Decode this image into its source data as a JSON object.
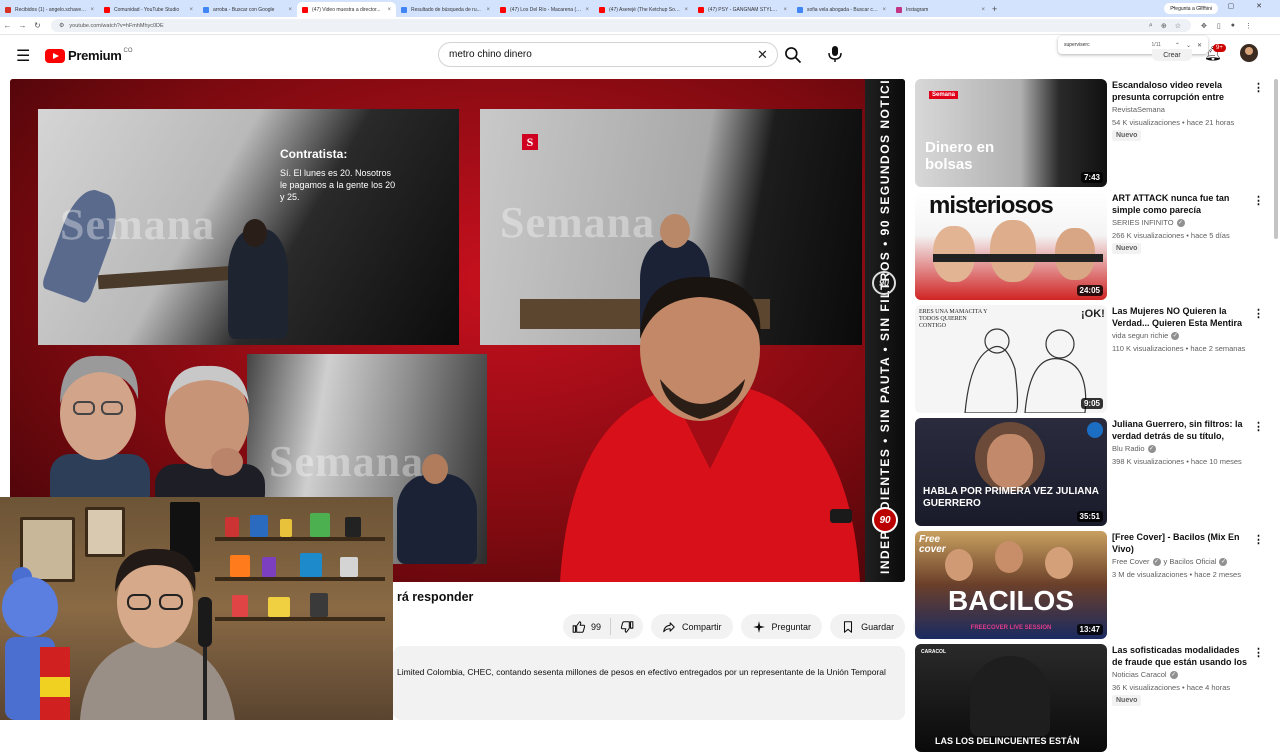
{
  "browser": {
    "tabs": [
      {
        "label": "Recibidos (1) - angelo.schavez...",
        "color": "#d93025",
        "active": false
      },
      {
        "label": "Comunidad - YouTube Studio",
        "color": "#ff0000",
        "active": false
      },
      {
        "label": "arroba - Buscar con Google",
        "color": "#4285f4",
        "active": false
      },
      {
        "label": "(47) Video muestra a director...",
        "color": "#ff0000",
        "active": true
      },
      {
        "label": "Resultado de búsqueda de ru...",
        "color": "#4285f4",
        "active": false
      },
      {
        "label": "(47) Los Del Río - Macarena (L...",
        "color": "#ff0000",
        "active": false
      },
      {
        "label": "(47) Aserejé (The Ketchup Song...",
        "color": "#ff0000",
        "active": false
      },
      {
        "label": "(47) PSY - GANGNAM STYLE(...",
        "color": "#ff0000",
        "active": false
      },
      {
        "label": "sofia vela abogada - Buscar co...",
        "color": "#4285f4",
        "active": false
      },
      {
        "label": "Instagram",
        "color": "#c13584",
        "active": false
      }
    ],
    "gemini_label": "Pregunta a Gemini",
    "url": "youtube.com/watch?v=hFmhMhyc0DE"
  },
  "header": {
    "logo_text": "Premium",
    "logo_country": "CO",
    "search_value": "metro chino dinero",
    "create_label": "Crear",
    "notif_count": "9+"
  },
  "findbar": {
    "query": "superviserc",
    "count": "1/11"
  },
  "player": {
    "caption_title": "Contratista:",
    "caption_body": "Sí. El lunes es 20. Nosotros le pagamos a la gente los 20 y 25.",
    "watermark": "Semana",
    "s_logo": "S",
    "vertical_text": "INDEPENDIENTES • SIN PAUTA • SIN FILTROS • 90 SEGUNDOS NOTICIAS",
    "badge": "90"
  },
  "video": {
    "title_fragment": "rá responder",
    "likes": "99",
    "share_label": "Compartir",
    "ask_label": "Preguntar",
    "save_label": "Guardar",
    "description": "Limited Colombia, CHEC, contando sesenta millones de pesos en efectivo entregados por un representante de la Unión Temporal"
  },
  "recommendations": [
    {
      "title": "Escandaloso video revela presunta corrupción entre contratistas del ...",
      "channel": "RevistaSemana",
      "verified": false,
      "meta": "54 K visualizaciones • hace 21 horas",
      "duration": "7:43",
      "new": "Nuevo",
      "thumb_text": "Dinero en bolsas",
      "thumb_tag": "Semana"
    },
    {
      "title": "ART ATTACK nunca fue tan simple como parecía",
      "channel": "SERIES INFINITO",
      "verified": true,
      "meta": "266 K visualizaciones • hace 5 días",
      "duration": "24:05",
      "new": "Nuevo",
      "thumb_text": "misteriosos"
    },
    {
      "title": "Las Mujeres NO Quieren la Verdad... Quieren Esta Mentira ...",
      "channel": "vida segun richie",
      "verified": true,
      "meta": "110 K visualizaciones • hace 2 semanas",
      "duration": "9:05",
      "new": "",
      "thumb_text": "ERES UNA MAMACITA Y TODOS QUIEREN CONTIGO",
      "thumb_tag": "¡OK!"
    },
    {
      "title": "Juliana Guerrero, sin filtros: la verdad detrás de su título, viajes ...",
      "channel": "Blu Radio",
      "verified": true,
      "meta": "398 K visualizaciones • hace 10 meses",
      "duration": "35:51",
      "new": "",
      "thumb_text": "HABLA POR PRIMERA VEZ JULIANA GUERRERO"
    },
    {
      "title": "[Free Cover] - Bacilos  (Mix En Vivo)",
      "channel": "Free Cover",
      "channel2": "y Bacilos Oficial",
      "verified": true,
      "meta": "3 M de visualizaciones • hace 2 meses",
      "duration": "13:47",
      "new": "",
      "thumb_text": "BACILOS",
      "thumb_tag": "Free cover",
      "thumb_sub": "FREECOVER LIVE SESSION"
    },
    {
      "title": "Las sofisticadas modalidades de fraude que están usando los ...",
      "channel": "Noticias Caracol",
      "verified": true,
      "meta": "36 K visualizaciones • hace 4 horas",
      "duration": "",
      "new": "Nuevo",
      "thumb_text": "LAS LOS DELINCUENTES ESTÁN",
      "thumb_tag": "CARACOL"
    }
  ]
}
